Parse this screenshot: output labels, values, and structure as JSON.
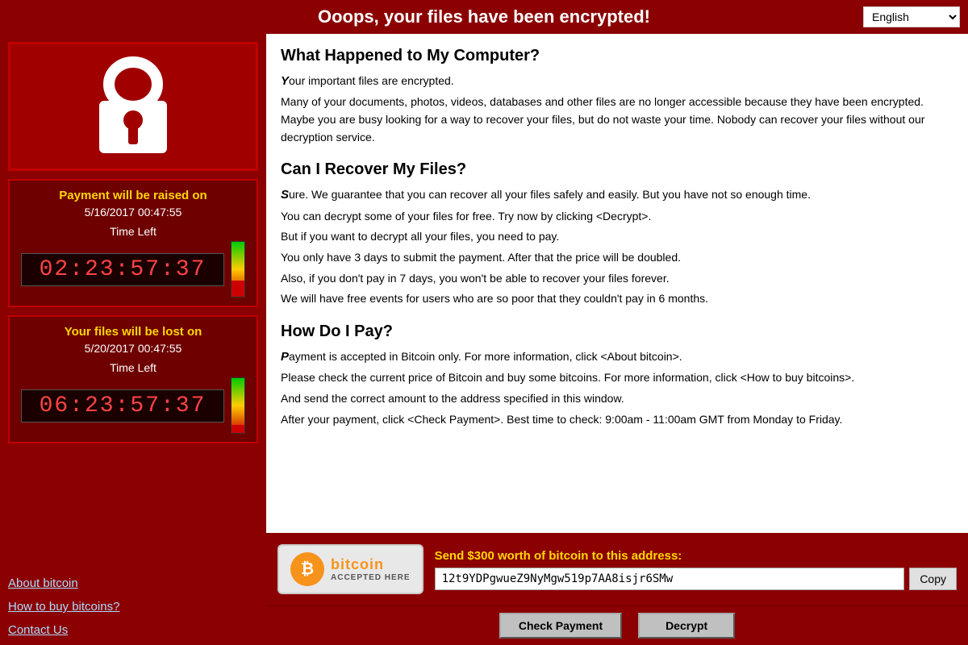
{
  "header": {
    "title": "Ooops, your files have been encrypted!",
    "language": "English"
  },
  "left": {
    "timer1": {
      "label": "Payment will be raised on",
      "date": "5/16/2017 00:47:55",
      "time_left_label": "Time Left",
      "digits": "02:23:57:37"
    },
    "timer2": {
      "label": "Your files will be lost on",
      "date": "5/20/2017 00:47:55",
      "time_left_label": "Time Left",
      "digits": "06:23:57:37"
    },
    "links": {
      "about_bitcoin": "About bitcoin",
      "how_to_buy": "How to buy bitcoins?",
      "contact_us": "Contact Us"
    }
  },
  "content": {
    "section1": {
      "heading": "What Happened to My Computer?",
      "para1_first": "Y",
      "para1_rest": "our important files are encrypted.",
      "para2": "Many of your documents, photos, videos, databases and other files are no longer accessible because they have been encrypted. Maybe you are busy looking for a way to recover your files, but do not waste your time. Nobody can recover your files without our decryption service."
    },
    "section2": {
      "heading": "Can I Recover My Files?",
      "para1_first": "S",
      "para1_rest": "ure. We guarantee that you can recover all your files safely and easily. But you have not so enough time.",
      "para2": "You can decrypt some of your files for free. Try now by clicking <Decrypt>.",
      "para3": "But if you want to decrypt all your files, you need to pay.",
      "para4": "You only have 3 days to submit the payment. After that the price will be doubled.",
      "para5": "Also, if you don't pay in 7 days, you won't be able to recover your files forever.",
      "para6": "We will have free events for users who are so poor that they couldn't pay in 6 months."
    },
    "section3": {
      "heading": "How Do I Pay?",
      "para1_first": "P",
      "para1_rest": "ayment is accepted in Bitcoin only. For more information, click <About bitcoin>.",
      "para2": "Please check the current price of Bitcoin and buy some bitcoins. For more information, click <How to buy bitcoins>.",
      "para3": "And send the correct amount to the address specified in this window.",
      "para4": "After your payment, click <Check Payment>. Best time to check: 9:00am - 11:00am GMT from Monday to Friday."
    }
  },
  "payment": {
    "bitcoin_word": "bitcoin",
    "accepted_here": "ACCEPTED HERE",
    "instruction": "Send $300 worth of bitcoin to this address:",
    "address": "12t9YDPgwueZ9NyMgw519p7AA8isjr6SMw",
    "copy_label": "Copy"
  },
  "action_buttons": {
    "check_payment": "Check Payment",
    "decrypt": "Decrypt"
  }
}
